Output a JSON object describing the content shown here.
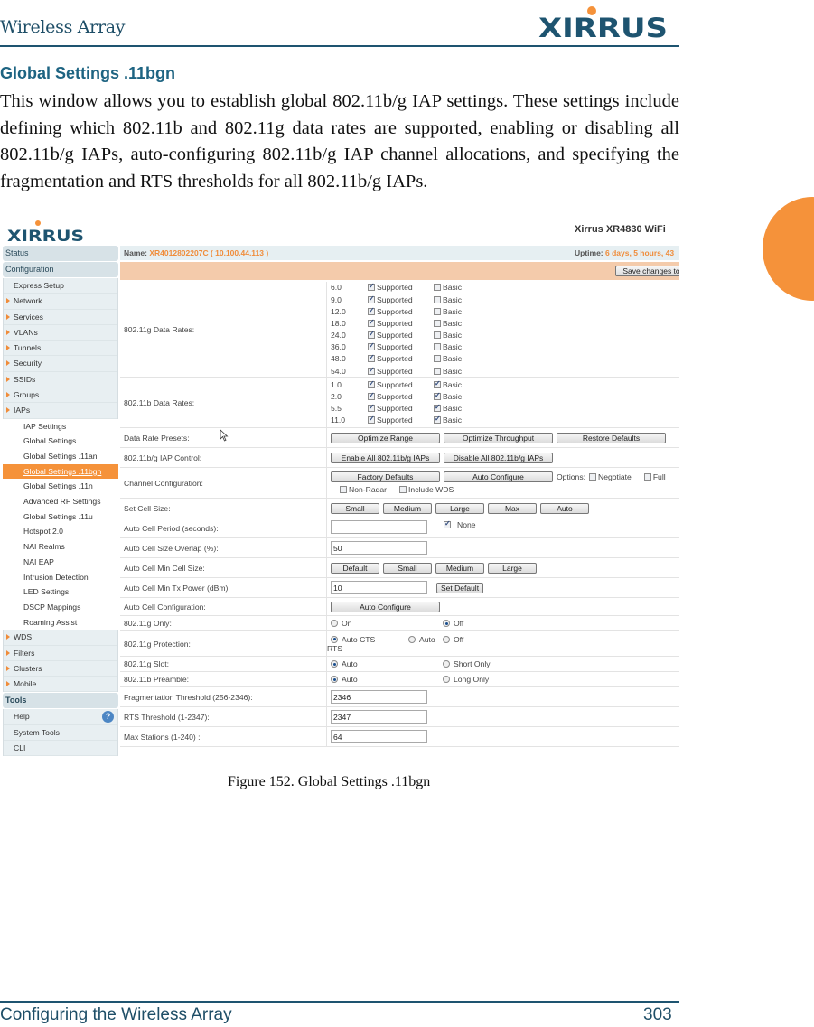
{
  "page": {
    "header_title": "Wireless Array",
    "logo_text": "XIRRUS",
    "section_title": "Global Settings .11bgn",
    "intro": "This window allows you to establish global 802.11b/g IAP settings. These settings include defining which 802.11b and 802.11g data rates are supported, enabling or disabling all 802.11b/g IAPs, auto-configuring 802.11b/g IAP channel allocations, and specifying the fragmentation and RTS thresholds for all 802.11b/g IAPs.",
    "caption": "Figure 152. Global Settings .11bgn",
    "footer_left": "Configuring the Wireless Array",
    "footer_page": "303",
    "accent_color": "#f5923a",
    "brand_color": "#1e5470"
  },
  "app": {
    "logo_text": "XIRRUS",
    "product": "Xirrus XR4830 WiFi",
    "name_label": "Name:",
    "name_value": "XR4012802207C   ( 10.100.44.113 )",
    "uptime_label": "Uptime:",
    "uptime_value": "6 days, 5 hours, 43",
    "save_button": "Save changes to"
  },
  "sidebar": {
    "status": "Status",
    "configuration": "Configuration",
    "config_items": [
      {
        "label": "Express Setup",
        "arrow": false
      },
      {
        "label": "Network",
        "arrow": true
      },
      {
        "label": "Services",
        "arrow": true
      },
      {
        "label": "VLANs",
        "arrow": true
      },
      {
        "label": "Tunnels",
        "arrow": true
      },
      {
        "label": "Security",
        "arrow": true
      },
      {
        "label": "SSIDs",
        "arrow": true
      },
      {
        "label": "Groups",
        "arrow": true
      },
      {
        "label": "IAPs",
        "arrow": true
      }
    ],
    "iap_items": [
      {
        "label": "IAP Settings"
      },
      {
        "label": "Global Settings"
      },
      {
        "label": "Global Settings .11an"
      },
      {
        "label": "Global Settings .11bgn",
        "active": true
      },
      {
        "label": "Global Settings .11n"
      },
      {
        "label": "Advanced RF Settings"
      },
      {
        "label": "Global Settings .11u"
      },
      {
        "label": "Hotspot 2.0"
      },
      {
        "label": "NAI Realms"
      },
      {
        "label": "NAI EAP"
      },
      {
        "label": "Intrusion Detection"
      },
      {
        "label": "LED Settings"
      },
      {
        "label": "DSCP Mappings"
      },
      {
        "label": "Roaming Assist"
      }
    ],
    "more_items": [
      {
        "label": "WDS"
      },
      {
        "label": "Filters"
      },
      {
        "label": "Clusters"
      },
      {
        "label": "Mobile"
      }
    ],
    "tools": "Tools",
    "tool_items": [
      {
        "label": "Help",
        "help_icon": true
      },
      {
        "label": "System Tools"
      },
      {
        "label": "CLI"
      }
    ]
  },
  "form": {
    "g_rates_label": "802.11g Data Rates:",
    "g_rates": [
      {
        "rate": "6.0",
        "supported": true,
        "basic": false
      },
      {
        "rate": "9.0",
        "supported": true,
        "basic": false
      },
      {
        "rate": "12.0",
        "supported": true,
        "basic": false
      },
      {
        "rate": "18.0",
        "supported": true,
        "basic": false
      },
      {
        "rate": "24.0",
        "supported": true,
        "basic": false
      },
      {
        "rate": "36.0",
        "supported": true,
        "basic": false
      },
      {
        "rate": "48.0",
        "supported": true,
        "basic": false
      },
      {
        "rate": "54.0",
        "supported": true,
        "basic": false
      }
    ],
    "b_rates_label": "802.11b Data Rates:",
    "b_rates": [
      {
        "rate": "1.0",
        "supported": true,
        "basic": true
      },
      {
        "rate": "2.0",
        "supported": true,
        "basic": true
      },
      {
        "rate": "5.5",
        "supported": true,
        "basic": true
      },
      {
        "rate": "11.0",
        "supported": true,
        "basic": true
      }
    ],
    "supported_label": "Supported",
    "basic_label": "Basic",
    "presets_label": "Data Rate Presets:",
    "presets_buttons": [
      "Optimize Range",
      "Optimize Throughput",
      "Restore Defaults"
    ],
    "iap_control_label": "802.11b/g IAP Control:",
    "iap_control_buttons": [
      "Enable All 802.11b/g IAPs",
      "Disable All 802.11b/g IAPs"
    ],
    "channel_label": "Channel Configuration:",
    "channel_buttons": [
      "Factory Defaults",
      "Auto Configure"
    ],
    "options_label": "Options:",
    "channel_options": [
      {
        "label": "Negotiate",
        "checked": false
      },
      {
        "label": "Full",
        "checked": false
      },
      {
        "label": "Non-Radar",
        "checked": false
      },
      {
        "label": "Include WDS",
        "checked": false
      }
    ],
    "cell_size_label": "Set Cell Size:",
    "cell_size_buttons": [
      "Small",
      "Medium",
      "Large",
      "Max",
      "Auto"
    ],
    "auto_period_label": "Auto Cell Period (seconds):",
    "auto_period_value": "",
    "none_label": "None",
    "none_checked": true,
    "overlap_label": "Auto Cell Size Overlap (%):",
    "overlap_value": "50",
    "min_cell_label": "Auto Cell Min Cell Size:",
    "min_cell_buttons": [
      "Default",
      "Small",
      "Medium",
      "Large"
    ],
    "min_tx_label": "Auto Cell Min Tx Power (dBm):",
    "min_tx_value": "10",
    "set_default_button": "Set Default",
    "auto_config_label": "Auto Cell Configuration:",
    "auto_config_button": "Auto Configure",
    "g_only_label": "802.11g Only:",
    "g_only_options": [
      {
        "label": "On",
        "selected": false
      },
      {
        "label": "Off",
        "selected": true
      }
    ],
    "protection_label": "802.11g Protection:",
    "protection_options": [
      {
        "label": "Auto CTS",
        "selected": true
      },
      {
        "label": "Auto",
        "selected": false
      },
      {
        "label": "Off",
        "selected": false
      }
    ],
    "protection_wrap": "RTS",
    "slot_label": "802.11g Slot:",
    "slot_options": [
      {
        "label": "Auto",
        "selected": true
      },
      {
        "label": "Short Only",
        "selected": false
      }
    ],
    "preamble_label": "802.11b Preamble:",
    "preamble_options": [
      {
        "label": "Auto",
        "selected": true
      },
      {
        "label": "Long Only",
        "selected": false
      }
    ],
    "frag_label": "Fragmentation Threshold (256-2346):",
    "frag_value": "2346",
    "rts_label": "RTS Threshold (1-2347):",
    "rts_value": "2347",
    "max_stations_label": "Max Stations (1-240) :",
    "max_stations_value": "64"
  }
}
